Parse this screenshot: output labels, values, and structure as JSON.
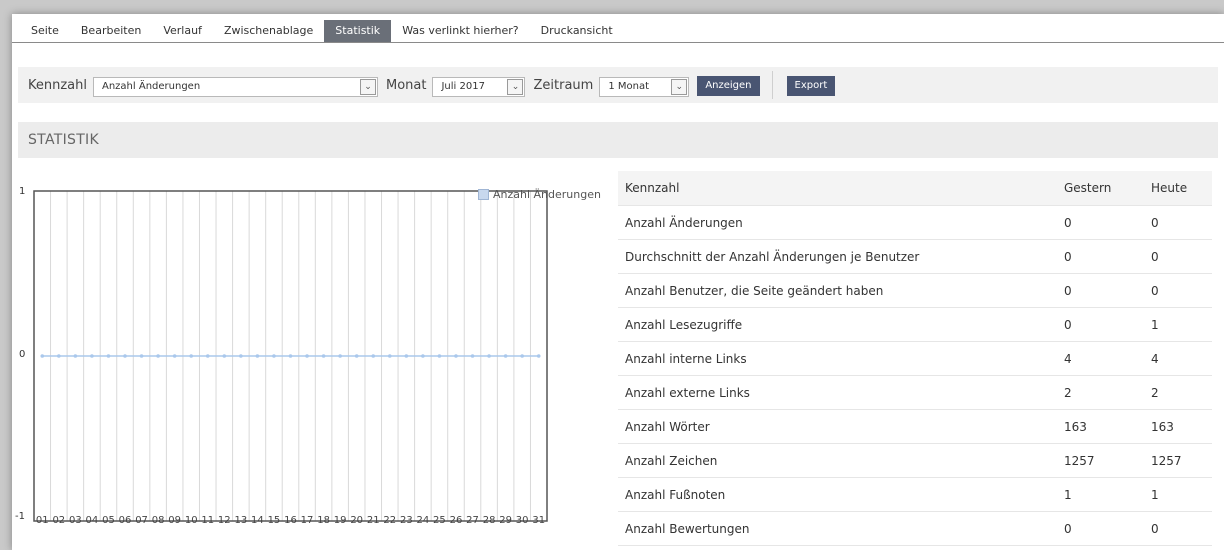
{
  "tabs": [
    {
      "label": "Seite"
    },
    {
      "label": "Bearbeiten"
    },
    {
      "label": "Verlauf"
    },
    {
      "label": "Zwischenablage"
    },
    {
      "label": "Statistik",
      "active": true
    },
    {
      "label": "Was verlinkt hierher?"
    },
    {
      "label": "Druckansicht"
    }
  ],
  "toolbar": {
    "kennzahl_label": "Kennzahl",
    "kennzahl_value": "Anzahl Änderungen",
    "monat_label": "Monat",
    "monat_value": "Juli 2017",
    "zeitraum_label": "Zeitraum",
    "zeitraum_value": "1 Monat",
    "show_button": "Anzeigen",
    "export_button": "Export"
  },
  "section_title": "STATISTIK",
  "chart_data": {
    "type": "line",
    "x": [
      "01",
      "02",
      "03",
      "04",
      "05",
      "06",
      "07",
      "08",
      "09",
      "10",
      "11",
      "12",
      "13",
      "14",
      "15",
      "16",
      "17",
      "18",
      "19",
      "20",
      "21",
      "22",
      "23",
      "24",
      "25",
      "26",
      "27",
      "28",
      "29",
      "30",
      "31"
    ],
    "series": [
      {
        "name": "Anzahl Änderungen",
        "values": [
          0,
          0,
          0,
          0,
          0,
          0,
          0,
          0,
          0,
          0,
          0,
          0,
          0,
          0,
          0,
          0,
          0,
          0,
          0,
          0,
          0,
          0,
          0,
          0,
          0,
          0,
          0,
          0,
          0,
          0,
          0
        ]
      }
    ],
    "ylim": [
      -1,
      1
    ],
    "yticks": [
      "1",
      "0",
      "-1"
    ],
    "grid": "vertical",
    "legend_position": "top-right",
    "series_color": "#aac8ec"
  },
  "table": {
    "headers": [
      "Kennzahl",
      "Gestern",
      "Heute"
    ],
    "rows": [
      [
        "Anzahl Änderungen",
        "0",
        "0"
      ],
      [
        "Durchschnitt der Anzahl Änderungen je Benutzer",
        "0",
        "0"
      ],
      [
        "Anzahl Benutzer, die Seite geändert haben",
        "0",
        "0"
      ],
      [
        "Anzahl Lesezugriffe",
        "0",
        "1"
      ],
      [
        "Anzahl interne Links",
        "4",
        "4"
      ],
      [
        "Anzahl externe Links",
        "2",
        "2"
      ],
      [
        "Anzahl Wörter",
        "163",
        "163"
      ],
      [
        "Anzahl Zeichen",
        "1257",
        "1257"
      ],
      [
        "Anzahl Fußnoten",
        "1",
        "1"
      ],
      [
        "Anzahl Bewertungen",
        "0",
        "0"
      ]
    ]
  }
}
